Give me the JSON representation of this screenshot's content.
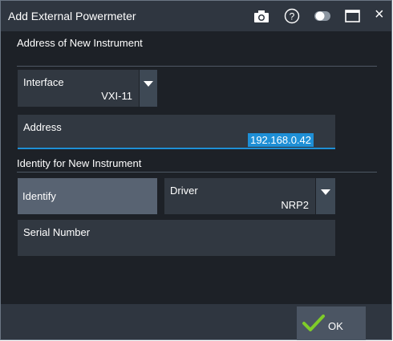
{
  "window": {
    "title": "Add External Powermeter",
    "icons": [
      "camera-icon",
      "help-icon",
      "toggle-icon",
      "maximize-icon",
      "close-icon"
    ],
    "close_symbol": "×"
  },
  "sections": {
    "address": "Address of New Instrument",
    "identity": "Identity for New Instrument"
  },
  "interface": {
    "label": "Interface",
    "value": "VXI-11"
  },
  "address": {
    "label": "Address",
    "value": "192.168.0.42"
  },
  "identify": {
    "label": "Identify"
  },
  "driver": {
    "label": "Driver",
    "value": "NRP2"
  },
  "serial": {
    "label": "Serial Number",
    "value": ""
  },
  "footer": {
    "ok_label": "OK"
  },
  "colors": {
    "accent": "#1e8fd6",
    "check": "#7fcc29"
  }
}
